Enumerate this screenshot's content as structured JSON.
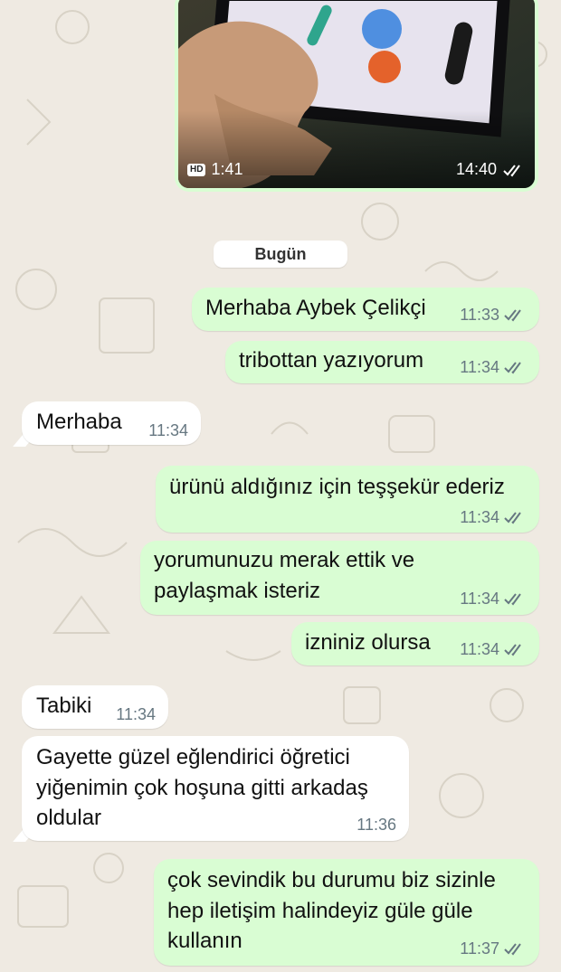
{
  "media": {
    "hd_badge": "HD",
    "duration": "1:41",
    "time": "14:40"
  },
  "date_divider": "Bugün",
  "messages": [
    {
      "dir": "out",
      "lines": [
        "Merhaba Aybek Çelikçi"
      ],
      "time": "11:33"
    },
    {
      "dir": "out",
      "lines": [
        "tribottan yazıyorum"
      ],
      "time": "11:34"
    },
    {
      "dir": "in",
      "lines": [
        "Merhaba"
      ],
      "time": "11:34"
    },
    {
      "dir": "out",
      "lines": [
        "ürünü aldığınız için teşşekür ederiz"
      ],
      "time": "11:34"
    },
    {
      "dir": "out",
      "lines": [
        "yorumunuzu merak ettik ve",
        "paylaşmak isteriz"
      ],
      "time": "11:34"
    },
    {
      "dir": "out",
      "lines": [
        "izniniz olursa"
      ],
      "time": "11:34"
    },
    {
      "dir": "in",
      "lines": [
        "Tabiki"
      ],
      "time": "11:34"
    },
    {
      "dir": "in",
      "lines": [
        "Gayette güzel eğlendirici öğretici",
        "yiğenimin çok hoşuna gitti arkadaş",
        "oldular"
      ],
      "time": "11:36"
    },
    {
      "dir": "out",
      "lines": [
        "çok sevindik bu durumu biz sizinle",
        "hep iletişim halindeyiz güle güle",
        "kullanın"
      ],
      "time": "11:37"
    }
  ]
}
